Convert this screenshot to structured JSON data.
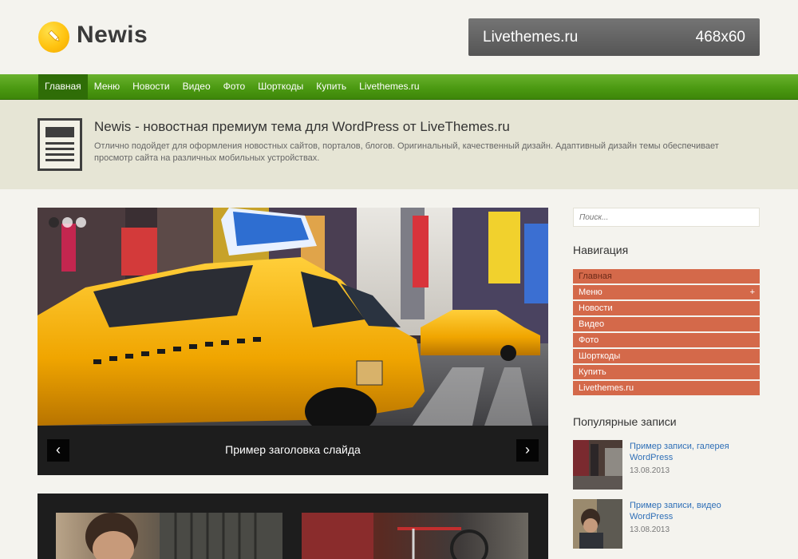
{
  "header": {
    "logo_text": "Newis",
    "banner_left": "Livethemes.ru",
    "banner_right": "468x60"
  },
  "nav": {
    "items": [
      "Главная",
      "Меню",
      "Новости",
      "Видео",
      "Фото",
      "Шорткоды",
      "Купить",
      "Livethemes.ru"
    ]
  },
  "intro": {
    "title": "Newis - новостная премиум тема для WordPress от LiveThemes.ru",
    "text": "Отлично подойдет для оформления новостных сайтов, порталов, блогов. Оригинальный, качественный дизайн. Адаптивный дизайн темы обеспечивает просмотр сайта на различных мобильных устройствах."
  },
  "slider": {
    "caption": "Пример заголовка слайда",
    "prev_icon": "chevron-left-icon",
    "next_icon": "chevron-right-icon"
  },
  "sidebar": {
    "search_placeholder": "Поиск...",
    "nav_title": "Навигация",
    "menu": [
      "Главная",
      "Меню",
      "Новости",
      "Видео",
      "Фото",
      "Шорткоды",
      "Купить",
      "Livethemes.ru"
    ],
    "menu_plus": "+",
    "popular_title": "Популярные записи",
    "popular": [
      {
        "title": "Пример записи, галерея WordPress",
        "date": "13.08.2013"
      },
      {
        "title": "Пример записи, видео WordPress",
        "date": "13.08.2013"
      }
    ]
  },
  "colors": {
    "nav_green": "#4c9a12",
    "menu_orange": "#d4694a",
    "link_blue": "#2f6fb7",
    "logo_yellow": "#ffc310"
  }
}
